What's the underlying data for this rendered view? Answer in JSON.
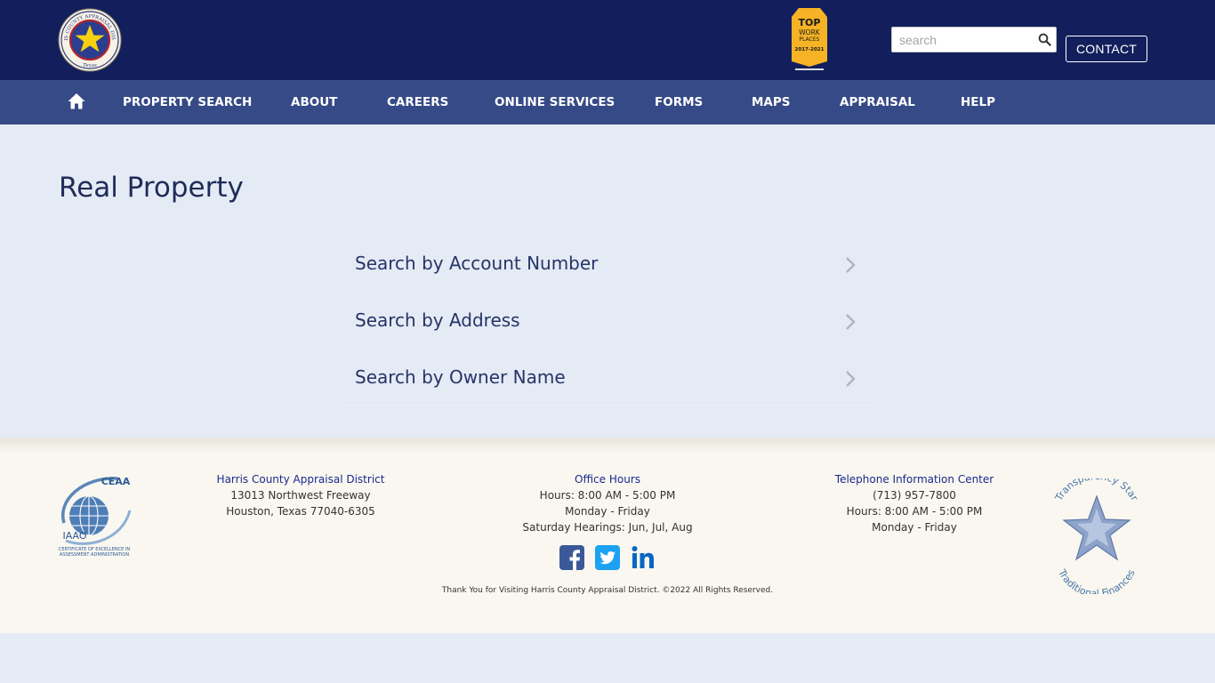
{
  "header": {
    "seal_text": [
      "HARRIS COUNTY APPRAISAL DISTRICT",
      "Texas"
    ],
    "badge_text": [
      "TOP",
      "WORK",
      "PLACES",
      "2017-2021"
    ],
    "search": {
      "placeholder": "search",
      "value": ""
    },
    "contact_label": "CONTACT"
  },
  "nav": {
    "items": [
      {
        "label": "PROPERTY SEARCH"
      },
      {
        "label": "ABOUT"
      },
      {
        "label": "CAREERS"
      },
      {
        "label": "ONLINE SERVICES"
      },
      {
        "label": "FORMS"
      },
      {
        "label": "MAPS"
      },
      {
        "label": "APPRAISAL"
      },
      {
        "label": "HELP"
      }
    ]
  },
  "main": {
    "title": "Real Property",
    "options": [
      {
        "label": "Search by Account Number"
      },
      {
        "label": "Search by Address"
      },
      {
        "label": "Search by Owner Name"
      }
    ]
  },
  "footer": {
    "ceaa_text": [
      "CEAA",
      "IAAO",
      "CERTIFICATE OF EXCELLENCE IN",
      "ASSESSMENT ADMINISTRATION"
    ],
    "district": {
      "title": "Harris County Appraisal District",
      "line1": "13013 Northwest Freeway",
      "line2": "Houston, Texas 77040-6305"
    },
    "hours": {
      "title": "Office Hours",
      "line1": "Hours: 8:00 AM - 5:00 PM",
      "line2": "Monday - Friday",
      "line3": "Saturday Hearings: Jun, Jul, Aug"
    },
    "phone": {
      "title": "Telephone Information Center",
      "line1": "(713) 957-7800",
      "line2": "Hours: 8:00 AM - 5:00 PM",
      "line3": "Monday - Friday"
    },
    "transparency_text": [
      "Transparency Star",
      "Traditional Finances"
    ],
    "social": [
      "facebook-icon",
      "twitter-icon",
      "linkedin-icon"
    ],
    "copyright": "Thank You for Visiting Harris County Appraisal District. ©2022 All Rights Reserved."
  },
  "colors": {
    "header_bg": "#121f5c",
    "nav_bg": "#354a86",
    "page_bg": "#e4ebf5",
    "footer_bg": "#f9f7f0",
    "title_text": "#1f2c59",
    "footer_heading": "#1a2a8c"
  }
}
